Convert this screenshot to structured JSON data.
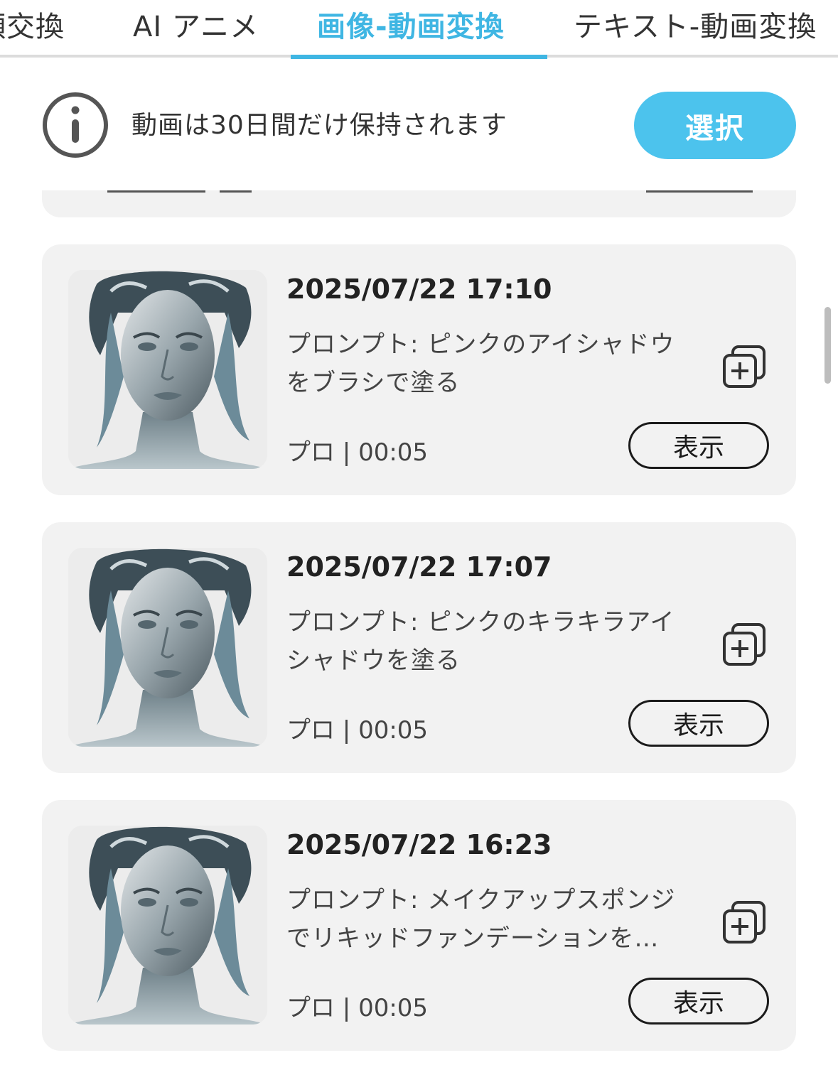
{
  "tabs": [
    {
      "label": "顔交換",
      "active": false
    },
    {
      "label": "AI アニメ",
      "active": false
    },
    {
      "label": "画像-動画変換",
      "active": true
    },
    {
      "label": "テキスト-動画変換",
      "active": false
    }
  ],
  "notice": {
    "icon": "info-icon",
    "text": "動画は30日間だけ保持されます",
    "select_label": "選択"
  },
  "colors": {
    "accent": "#3fb6e3",
    "select_button": "#4cc3ed",
    "card_background": "#f2f2f2"
  },
  "videos": [
    {
      "date": "2025/07/22 17:10",
      "prompt": "プロンプト: ピンクのアイシャドウをブラシで塗る",
      "meta": "プロ | 00:05",
      "view_label": "表示"
    },
    {
      "date": "2025/07/22 17:07",
      "prompt": "プロンプト: ピンクのキラキラアイシャドウを塗る",
      "meta": "プロ | 00:05",
      "view_label": "表示"
    },
    {
      "date": "2025/07/22 16:23",
      "prompt": "プロンプト: メイクアップスポンジでリキッドファンデーションを…",
      "meta": "プロ | 00:05",
      "view_label": "表示"
    }
  ]
}
